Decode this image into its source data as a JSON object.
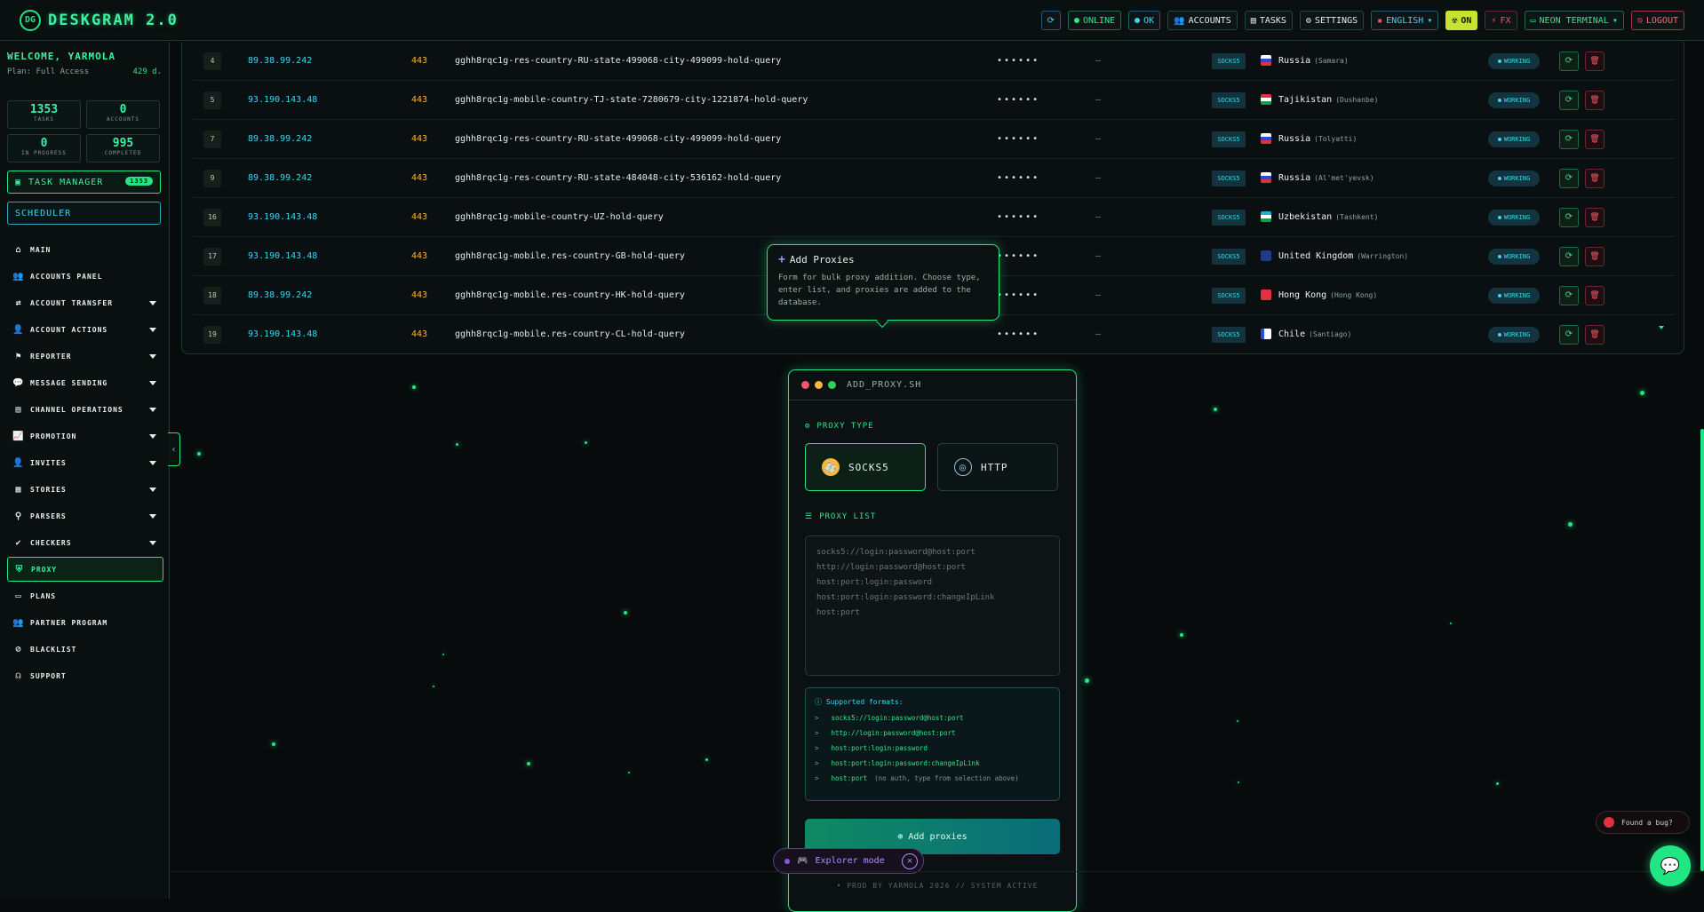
{
  "app": {
    "title": "DESKGRAM 2.0",
    "logo_mark": "DG"
  },
  "header": {
    "refresh_icon": "refresh-icon",
    "online": "ONLINE",
    "ok": "OK",
    "accounts": "ACCOUNTS",
    "tasks": "TASKS",
    "settings": "SETTINGS",
    "language": "ENGLISH",
    "on": "ON",
    "fx": "FX",
    "theme": "NEON TERMINAL",
    "logout": "LOGOUT"
  },
  "sidebar": {
    "welcome": "WELCOME, YARMOLA",
    "plan": "Plan: Full Access",
    "days_left": "429 d.",
    "stats": [
      {
        "value": "1353",
        "label": "TASKS"
      },
      {
        "value": "0",
        "label": "ACCOUNTS"
      },
      {
        "value": "0",
        "label": "IN PROGRESS"
      },
      {
        "value": "995",
        "label": "COMPLETED"
      }
    ],
    "task_manager": "TASK MANAGER",
    "task_manager_badge": "1353",
    "scheduler": "SCHEDULER",
    "items": [
      {
        "label": "MAIN",
        "icon": "home-icon",
        "has_children": false
      },
      {
        "label": "ACCOUNTS PANEL",
        "icon": "users-icon",
        "has_children": false
      },
      {
        "label": "ACCOUNT TRANSFER",
        "icon": "transfer-icon",
        "has_children": true
      },
      {
        "label": "ACCOUNT ACTIONS",
        "icon": "user-gear-icon",
        "has_children": true
      },
      {
        "label": "REPORTER",
        "icon": "flag-icon",
        "has_children": true
      },
      {
        "label": "MESSAGE SENDING",
        "icon": "chat-icon",
        "has_children": true
      },
      {
        "label": "CHANNEL OPERATIONS",
        "icon": "channel-icon",
        "has_children": true
      },
      {
        "label": "PROMOTION",
        "icon": "chart-line-icon",
        "has_children": true
      },
      {
        "label": "INVITES",
        "icon": "user-plus-icon",
        "has_children": true
      },
      {
        "label": "STORIES",
        "icon": "stories-icon",
        "has_children": true
      },
      {
        "label": "PARSERS",
        "icon": "search-icon",
        "has_children": true
      },
      {
        "label": "CHECKERS",
        "icon": "check-circle-icon",
        "has_children": true
      },
      {
        "label": "PROXY",
        "icon": "shield-icon",
        "has_children": false,
        "active": true
      },
      {
        "label": "PLANS",
        "icon": "card-icon",
        "has_children": false
      },
      {
        "label": "PARTNER PROGRAM",
        "icon": "partner-icon",
        "has_children": false
      },
      {
        "label": "BLACKLIST",
        "icon": "user-block-icon",
        "has_children": false
      },
      {
        "label": "SUPPORT",
        "icon": "headset-icon",
        "has_children": false
      }
    ]
  },
  "table": {
    "rows": [
      {
        "id": "4",
        "ip": "89.38.99.242",
        "port": "443",
        "login": "gghh8rqc1g-res-country-RU-state-499068-city-499099-hold-query",
        "password": "••••••",
        "extra": "—",
        "type": "SOCKS5",
        "country": "Russia",
        "city": "(Samara)",
        "flag": "ru",
        "status": "WORKING"
      },
      {
        "id": "5",
        "ip": "93.190.143.48",
        "port": "443",
        "login": "gghh8rqc1g-mobile-country-TJ-state-7280679-city-1221874-hold-query",
        "password": "••••••",
        "extra": "—",
        "type": "SOCKS5",
        "country": "Tajikistan",
        "city": "(Dushanbe)",
        "flag": "tj",
        "status": "WORKING"
      },
      {
        "id": "7",
        "ip": "89.38.99.242",
        "port": "443",
        "login": "gghh8rqc1g-res-country-RU-state-499068-city-499099-hold-query",
        "password": "••••••",
        "extra": "—",
        "type": "SOCKS5",
        "country": "Russia",
        "city": "(Tolyatti)",
        "flag": "ru",
        "status": "WORKING"
      },
      {
        "id": "9",
        "ip": "89.38.99.242",
        "port": "443",
        "login": "gghh8rqc1g-res-country-RU-state-484048-city-536162-hold-query",
        "password": "••••••",
        "extra": "—",
        "type": "SOCKS5",
        "country": "Russia",
        "city": "(Al'met'yevsk)",
        "flag": "ru",
        "status": "WORKING"
      },
      {
        "id": "16",
        "ip": "93.190.143.48",
        "port": "443",
        "login": "gghh8rqc1g-mobile-country-UZ-hold-query",
        "password": "••••••",
        "extra": "—",
        "type": "SOCKS5",
        "country": "Uzbekistan",
        "city": "(Tashkent)",
        "flag": "uz",
        "status": "WORKING"
      },
      {
        "id": "17",
        "ip": "93.190.143.48",
        "port": "443",
        "login": "gghh8rqc1g-mobile.res-country-GB-hold-query",
        "password": "••••••",
        "extra": "—",
        "type": "SOCKS5",
        "country": "United Kingdom",
        "city": "(Warrington)",
        "flag": "gb",
        "status": "WORKING"
      },
      {
        "id": "18",
        "ip": "89.38.99.242",
        "port": "443",
        "login": "gghh8rqc1g-mobile.res-country-HK-hold-query",
        "password": "••••••",
        "extra": "—",
        "type": "SOCKS5",
        "country": "Hong Kong",
        "city": "(Hong Kong)",
        "flag": "hk",
        "status": "WORKING"
      },
      {
        "id": "19",
        "ip": "93.190.143.48",
        "port": "443",
        "login": "gghh8rqc1g-mobile.res-country-CL-hold-query",
        "password": "••••••",
        "extra": "—",
        "type": "SOCKS5",
        "country": "Chile",
        "city": "(Santiago)",
        "flag": "cl",
        "status": "WORKING"
      }
    ]
  },
  "tooltip": {
    "title": "Add Proxies",
    "description": "Form for bulk proxy addition. Choose type, enter list, and proxies are added to the database."
  },
  "panel": {
    "window_title": "ADD_PROXY.SH",
    "proxy_type_label": "PROXY TYPE",
    "type_socks": "SOCKS5",
    "type_http": "HTTP",
    "proxy_list_label": "PROXY LIST",
    "placeholder": "socks5://login:password@host:port\nhttp://login:password@host:port\nhost:port:login:password\nhost:port:login:password:changeIpLink\nhost:port",
    "formats_title": "Supported formats:",
    "formats": [
      {
        "text": "socks5://login:password@host:port",
        "note": ""
      },
      {
        "text": "http://login:password@host:port",
        "note": ""
      },
      {
        "text": "host:port:login:password",
        "note": ""
      },
      {
        "text": "host:port:login:password:changeIpLink",
        "note": ""
      },
      {
        "text": "host:port",
        "note": "(no auth, type from selection above)"
      }
    ],
    "submit": "Add proxies"
  },
  "explorer": {
    "label": "Explorer mode"
  },
  "footer": {
    "text": "• PROD BY YARMOLA 2026   // SYSTEM ACTIVE"
  },
  "bug": {
    "label": "Found a bug?"
  },
  "colors": {
    "accent": "#22e584",
    "cyan": "#3bd6f0",
    "orange": "#ffb52a",
    "danger": "#f0576b",
    "purple": "#b68bff"
  }
}
